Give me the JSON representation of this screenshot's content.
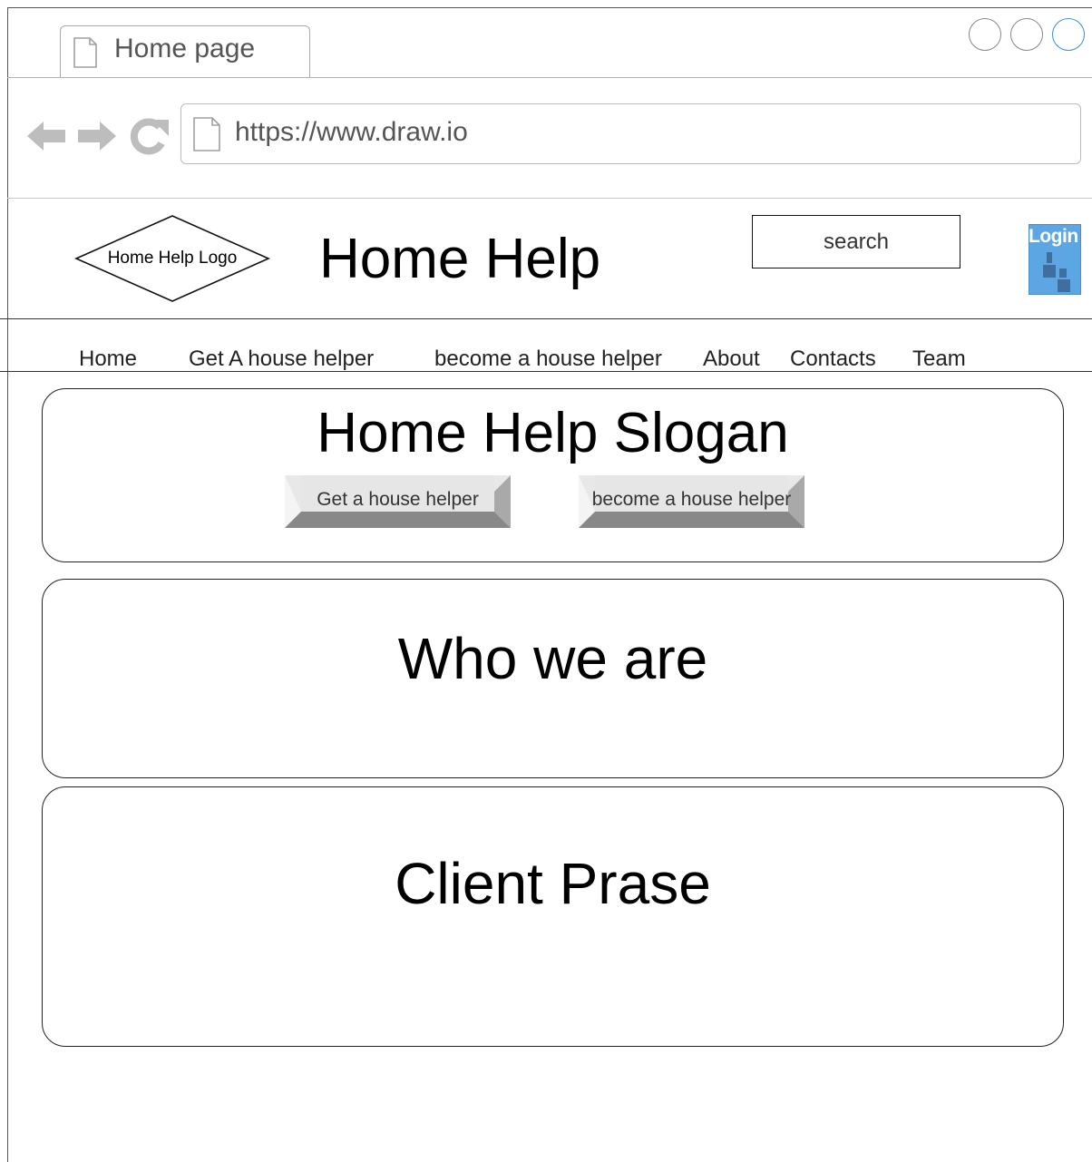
{
  "browser": {
    "tab_title": "Home page",
    "url": "https://www.draw.io",
    "colors": {
      "icon_gray": "#bdbdbd",
      "accent": "#3d8fd6"
    },
    "icons": [
      "page-icon",
      "back-arrow-icon",
      "forward-arrow-icon",
      "reload-icon"
    ]
  },
  "header": {
    "logo_text": "Home Help Logo",
    "site_title": "Home Help",
    "search_placeholder": "search",
    "login_label": "Login",
    "login_color": "#5da6e4"
  },
  "menu": {
    "items": [
      {
        "label": "Home"
      },
      {
        "label": "Get A house helper"
      },
      {
        "label": "become a house helper"
      },
      {
        "label": "About"
      },
      {
        "label": "Contacts"
      },
      {
        "label": "Team"
      }
    ]
  },
  "hero": {
    "title": "Home Help Slogan",
    "buttons": [
      {
        "label": "Get a house helper"
      },
      {
        "label": "become a house helper"
      }
    ]
  },
  "sections": {
    "who": {
      "title": "Who we are"
    },
    "client": {
      "title": "Client Prase"
    }
  }
}
